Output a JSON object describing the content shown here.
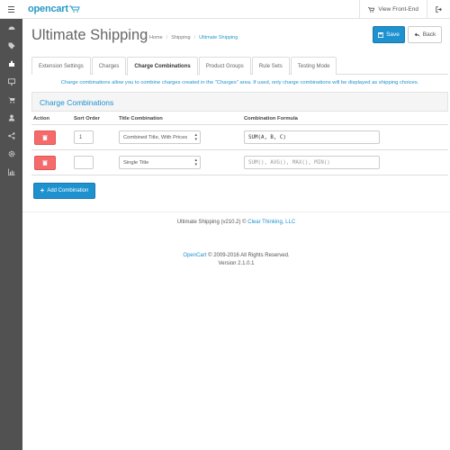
{
  "header": {
    "logo_text": "opencart",
    "view_frontend": "View Front-End",
    "brand_color": "#2699c7"
  },
  "sidebar": {
    "icons": [
      "dashboard-icon",
      "tags-icon",
      "puzzle-icon",
      "desktop-icon",
      "cart-icon",
      "user-icon",
      "share-icon",
      "cog-icon",
      "chart-icon"
    ],
    "background": "#515151"
  },
  "page": {
    "title": "Ultimate Shipping",
    "breadcrumb": [
      "Home",
      "Shipping",
      "Ultimate Shipping"
    ],
    "save_label": "Save",
    "back_label": "Back"
  },
  "tabs": [
    {
      "label": "Extension Settings",
      "active": false
    },
    {
      "label": "Charges",
      "active": false
    },
    {
      "label": "Charge Combinations",
      "active": true
    },
    {
      "label": "Product Groups",
      "active": false
    },
    {
      "label": "Rule Sets",
      "active": false
    },
    {
      "label": "Testing Mode",
      "active": false
    }
  ],
  "info_text": "Charge combinations allow you to combine charges created in the \"Charges\" area. If used, only charge combinations will be displayed as shipping choices.",
  "panel": {
    "heading": "Charge Combinations"
  },
  "table": {
    "headers": {
      "action": "Action",
      "sort_order": "Sort Order",
      "title_combination": "Title Combination",
      "combination_formula": "Combination Formula"
    },
    "rows": [
      {
        "sort_order": "1",
        "title_combination": "Combined Title, With Prices",
        "formula_value": "SUM(A, B, C)",
        "formula_placeholder": ""
      },
      {
        "sort_order": "",
        "title_combination": "Single Title",
        "formula_value": "",
        "formula_placeholder": "SUM(), AVG(), MAX(), MIN()"
      }
    ],
    "add_label": "Add Combination"
  },
  "footer": {
    "credit_prefix": "Ultimate Shipping (v210.2) © ",
    "credit_link": "Clear Thinking, LLC",
    "copy_link": "OpenCart",
    "copy_text": " © 2009-2016 All Rights Reserved.",
    "version": "Version 2.1.0.1"
  },
  "colors": {
    "primary": "#1e91cf",
    "danger": "#f56b6b"
  }
}
